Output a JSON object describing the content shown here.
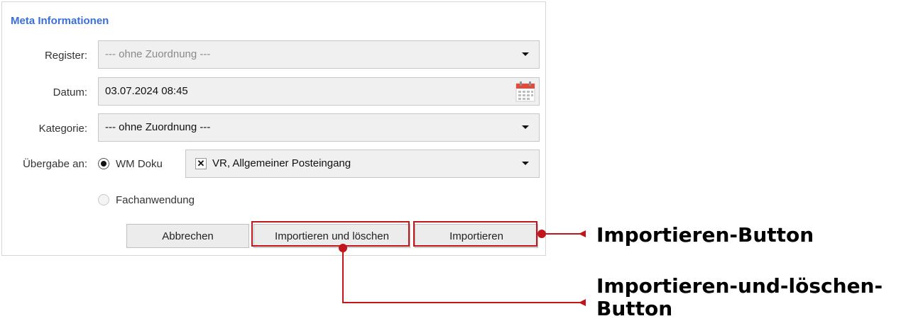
{
  "panel": {
    "title": "Meta Informationen"
  },
  "form": {
    "register": {
      "label": "Register:",
      "value": "--- ohne Zuordnung ---"
    },
    "datum": {
      "label": "Datum:",
      "value": "03.07.2024 08:45"
    },
    "kategorie": {
      "label": "Kategorie:",
      "value": "--- ohne Zuordnung ---"
    },
    "uebergabe": {
      "label": "Übergabe an:",
      "options": [
        {
          "label": "WM Doku",
          "checked": true
        },
        {
          "label": "Fachanwendung",
          "checked": false
        }
      ],
      "recipient": {
        "check_mark": "✕",
        "value": "VR, Allgemeiner Posteingang"
      }
    }
  },
  "buttons": {
    "cancel": "Abbrechen",
    "import_delete": "Importieren und löschen",
    "import": "Importieren"
  },
  "annotations": {
    "import_button": "Importieren-Button",
    "import_delete_button_line1": "Importieren-und-löschen-",
    "import_delete_button_line2": "Button"
  },
  "colors": {
    "title": "#3a6fd8",
    "highlight": "#c0161c",
    "calendar_header": "#e24b3b"
  }
}
